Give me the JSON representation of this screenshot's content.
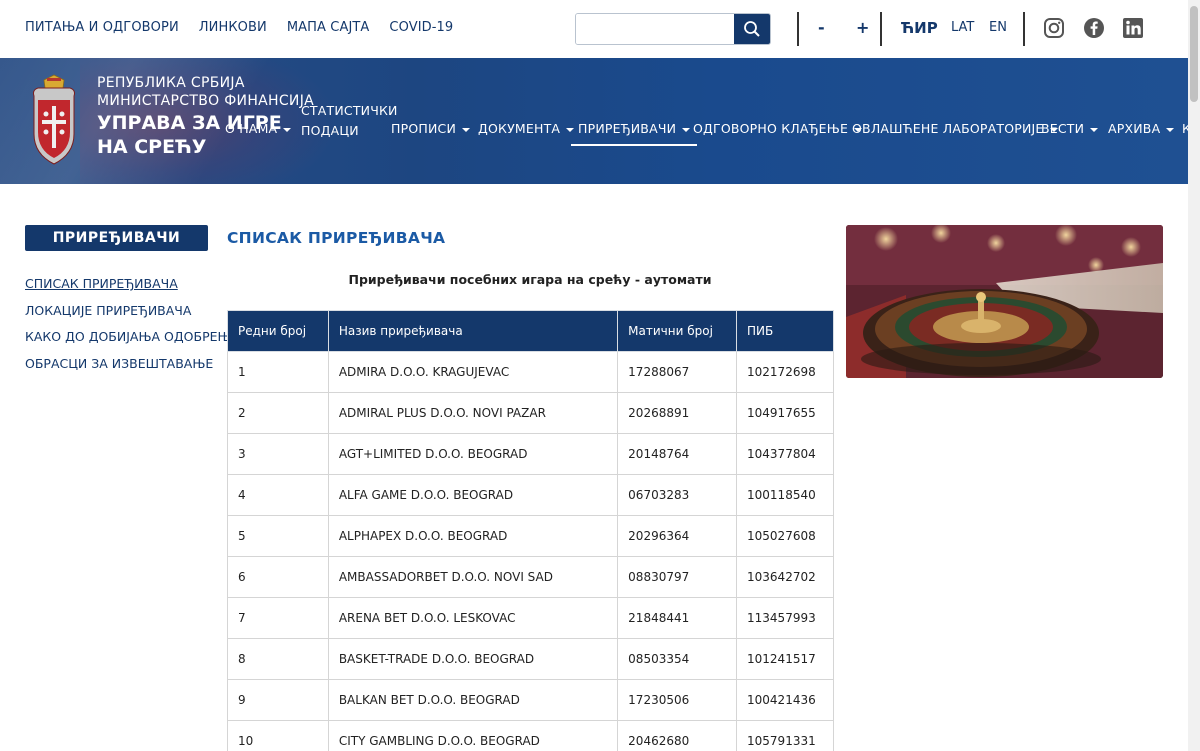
{
  "topbar": {
    "links": [
      "ПИТАЊА И ОДГОВОРИ",
      "ЛИНКОВИ",
      "МАПА САЈТА",
      "COVID-19"
    ],
    "search_placeholder": "",
    "font_minus": "-",
    "font_plus": "+",
    "languages": [
      "ЋИР",
      "LAT",
      "EN"
    ],
    "active_language": "ЋИР",
    "social_icons": [
      "instagram-icon",
      "facebook-icon",
      "linkedin-icon"
    ]
  },
  "header": {
    "org_line1": "РЕПУБЛИКА СРБИЈА",
    "org_line2": "МИНИСТАРСТВО ФИНАНСИЈА",
    "org_line3": "УПРАВА ЗА ИГРЕ НА СРЕЋУ",
    "nav": [
      {
        "label": "О НАМА",
        "has_menu": true
      },
      {
        "label": "СТАТИСТИЧКИ ПОДАЦИ",
        "has_menu": false
      },
      {
        "label": "ПРОПИСИ",
        "has_menu": true
      },
      {
        "label": "ДОКУМЕНТА",
        "has_menu": true
      },
      {
        "label": "ПРИРЕЂИВАЧИ",
        "has_menu": true
      },
      {
        "label": "ОДГОВОРНО КЛАЂЕЊЕ",
        "has_menu": true
      },
      {
        "label": "ОВЛАШЋЕНЕ ЛАБОРАТОРИЈЕ",
        "has_menu": true
      },
      {
        "label": "ВЕСТИ",
        "has_menu": true
      },
      {
        "label": "АРХИВА",
        "has_menu": true
      },
      {
        "label": "К",
        "has_menu": false
      }
    ],
    "active_nav": "ПРИРЕЂИВАЧИ"
  },
  "sidebar": {
    "title": "ПРИРЕЂИВАЧИ",
    "items": [
      "СПИСАК ПРИРЕЂИВАЧА",
      "ЛОКАЦИЈЕ ПРИРЕЂИВАЧА",
      "КАКО ДО ДОБИЈАЊА ОДОБРЕЊА",
      "ОБРАСЦИ ЗА ИЗВЕШТАВАЊЕ"
    ],
    "active_item": "СПИСАК ПРИРЕЂИВАЧА"
  },
  "main": {
    "title": "СПИСАК ПРИРЕЂИВАЧА",
    "subtitle": "Приређивачи посебних игара на срећу - аутомати",
    "table": {
      "columns": [
        "Редни број",
        "Назив приређивача",
        "Матични број",
        "ПИБ"
      ],
      "rows": [
        [
          "1",
          "ADMIRA D.O.O. KRAGUJEVAC",
          "17288067",
          "102172698"
        ],
        [
          "2",
          "ADMIRAL PLUS D.O.O. NOVI PAZAR",
          "20268891",
          "104917655"
        ],
        [
          "3",
          "AGT+LIMITED D.O.O. BEOGRAD",
          "20148764",
          "104377804"
        ],
        [
          "4",
          "ALFA GAME D.O.O. BEOGRAD",
          "06703283",
          "100118540"
        ],
        [
          "5",
          "ALPHAPEX D.O.O. BEOGRAD",
          "20296364",
          "105027608"
        ],
        [
          "6",
          "AMBASSADORBET D.O.O. NOVI SAD",
          "08830797",
          "103642702"
        ],
        [
          "7",
          "ARENA BET D.O.O. LESKOVAC",
          "21848441",
          "113457993"
        ],
        [
          "8",
          "BASKET-TRADE D.O.O. BEOGRAD",
          "08503354",
          "101241517"
        ],
        [
          "9",
          "BALKAN BET D.O.O. BEOGRAD",
          "17230506",
          "100421436"
        ],
        [
          "10",
          "CITY GAMBLING D.O.O. BEOGRAD",
          "20462680",
          "105791331"
        ]
      ]
    }
  },
  "colors": {
    "brand_navy": "#14386b",
    "link_blue": "#1b5aa5",
    "header_blue": "#1d4681"
  }
}
